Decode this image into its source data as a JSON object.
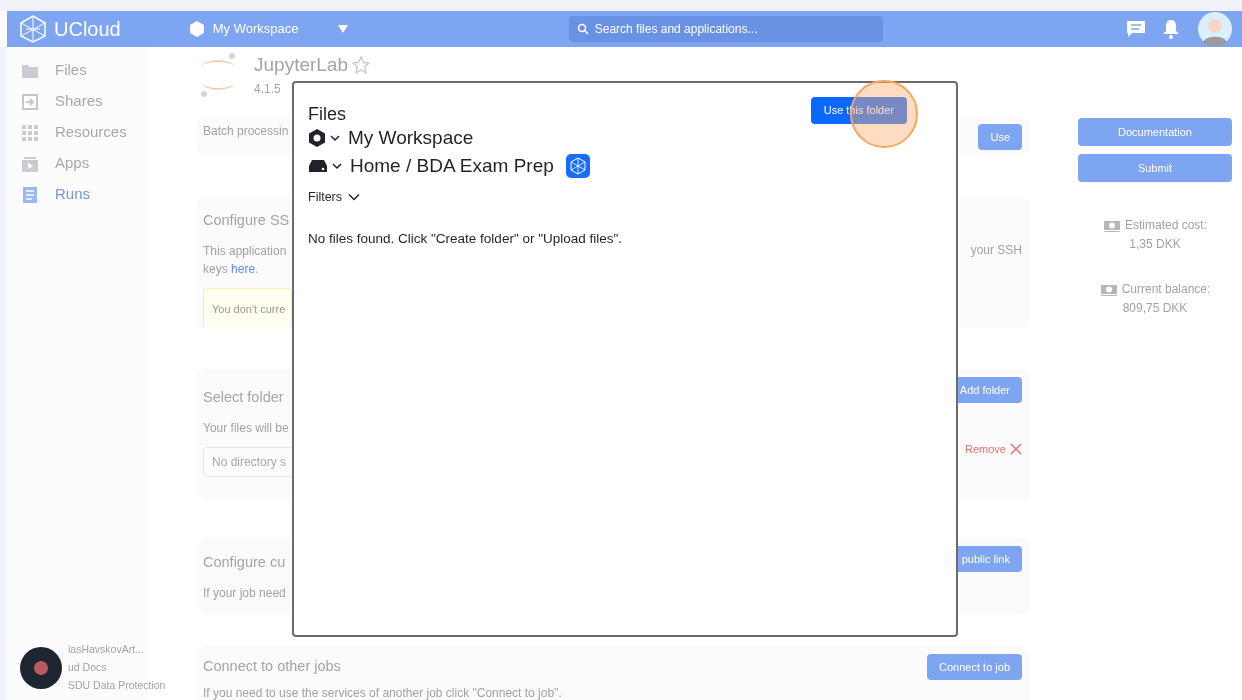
{
  "topbar": {
    "logo_text": "UCloud",
    "workspace": "My Workspace",
    "search": {
      "placeholder": "Search files and applications..."
    }
  },
  "sidebar": {
    "items": [
      {
        "label": "Files",
        "selected": false
      },
      {
        "label": "Shares",
        "selected": false
      },
      {
        "label": "Resources",
        "selected": false
      },
      {
        "label": "Apps",
        "selected": false
      },
      {
        "label": "Runs",
        "selected": true
      }
    ],
    "footer_links": [
      "iasHavskovArt...",
      "ud Docs",
      "SDU Data Protection"
    ]
  },
  "app": {
    "name": "JupyterLab",
    "version": "4.1.5",
    "starred": false
  },
  "sections": [
    {
      "texts": [
        "Batch processin"
      ],
      "button": "Use"
    },
    {
      "title": "Configure SS",
      "texts": [
        "This application"
      ],
      "link_line": {
        "before": "keys",
        "link": "here",
        "after": "."
      },
      "right_text": "your SSH",
      "alert": "You don't curre"
    },
    {
      "title": "Select folder",
      "texts": [
        "Your files will be"
      ],
      "button": "Add folder",
      "remove": "Remove",
      "field": {
        "placeholder": "No directory s"
      }
    },
    {
      "title": "Configure cu",
      "texts": [
        "If your job need"
      ],
      "button": "public link"
    },
    {
      "title": "Connect to other jobs",
      "texts": [
        "If you need to use the services of another job click \"Connect to job\"."
      ],
      "button": "Connect to job"
    }
  ],
  "right_panel": {
    "buttons": [
      "Documentation",
      "Submit"
    ],
    "costs": [
      {
        "label": "Estimated cost:",
        "value": "1,35 DKK"
      },
      {
        "label": "Current balance:",
        "value": "809,75 DKK"
      }
    ]
  },
  "dialog": {
    "title": "Files",
    "button": "Use this folder",
    "workspace": "My Workspace",
    "path": "Home / BDA Exam Prep",
    "filters": "Filters",
    "empty_message": "No files found. Click \"Create folder\" or \"Upload files\"."
  }
}
